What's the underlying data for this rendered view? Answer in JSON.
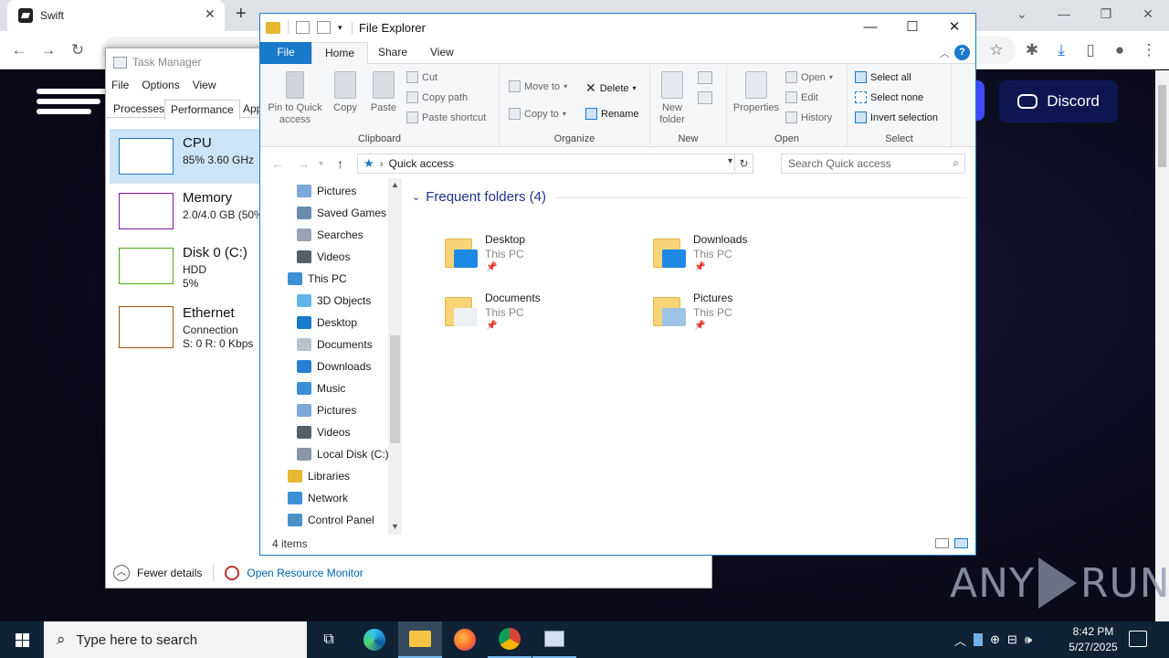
{
  "chrome": {
    "tab_title": "Swift",
    "tab_close": "✕",
    "new_tab": "+",
    "omnibox_text": "",
    "discord_label": "Discord"
  },
  "watermark": {
    "left": "ANY",
    "right": "RUN"
  },
  "taskmgr": {
    "title": "Task Manager",
    "menu": [
      "File",
      "Options",
      "View"
    ],
    "tabs": [
      "Processes",
      "Performance",
      "App"
    ],
    "items": [
      {
        "name": "CPU",
        "sub1": "85%  3.60 GHz",
        "sub2": "",
        "color": "#1979ca"
      },
      {
        "name": "Memory",
        "sub1": "2.0/4.0 GB (50%",
        "sub2": "",
        "color": "#8b12ae"
      },
      {
        "name": "Disk 0 (C:)",
        "sub1": "HDD",
        "sub2": "5%",
        "color": "#4da60c"
      },
      {
        "name": "Ethernet",
        "sub1": "Connection",
        "sub2": "S: 0  R: 0 Kbps",
        "color": "#a74f01"
      }
    ],
    "fewer_details": "Fewer details",
    "open_resmon": "Open Resource Monitor"
  },
  "explorer": {
    "title": "File Explorer",
    "ribbon_tabs": {
      "file": "File",
      "home": "Home",
      "share": "Share",
      "view": "View"
    },
    "clipboard": {
      "label": "Clipboard",
      "pin": "Pin to Quick access",
      "copy": "Copy",
      "paste": "Paste",
      "cut": "Cut",
      "copy_path": "Copy path",
      "paste_shortcut": "Paste shortcut"
    },
    "organize": {
      "label": "Organize",
      "move_to": "Move to",
      "copy_to": "Copy to",
      "delete": "Delete",
      "rename": "Rename"
    },
    "new": {
      "label": "New",
      "new_folder": "New folder"
    },
    "open": {
      "label": "Open",
      "properties": "Properties",
      "open": "Open",
      "edit": "Edit",
      "history": "History"
    },
    "select": {
      "label": "Select",
      "select_all": "Select all",
      "select_none": "Select none",
      "invert": "Invert selection"
    },
    "address": "Quick access",
    "search_placeholder": "Search Quick access",
    "nav": [
      {
        "label": "Pictures",
        "indent": 1,
        "icon": "#7da7d9"
      },
      {
        "label": "Saved Games",
        "indent": 1,
        "icon": "#6b8cae"
      },
      {
        "label": "Searches",
        "indent": 1,
        "icon": "#9aa4b0"
      },
      {
        "label": "Videos",
        "indent": 1,
        "icon": "#555d66"
      },
      {
        "label": "This PC",
        "indent": 0,
        "icon": "#3d8fd6"
      },
      {
        "label": "3D Objects",
        "indent": 1,
        "icon": "#5fb6e8"
      },
      {
        "label": "Desktop",
        "indent": 1,
        "icon": "#1979ca"
      },
      {
        "label": "Documents",
        "indent": 1,
        "icon": "#b8c2cc"
      },
      {
        "label": "Downloads",
        "indent": 1,
        "icon": "#2a7fd4"
      },
      {
        "label": "Music",
        "indent": 1,
        "icon": "#3a8fd9"
      },
      {
        "label": "Pictures",
        "indent": 1,
        "icon": "#7da7d9"
      },
      {
        "label": "Videos",
        "indent": 1,
        "icon": "#555d66"
      },
      {
        "label": "Local Disk (C:)",
        "indent": 1,
        "icon": "#8a96a3"
      },
      {
        "label": "Libraries",
        "indent": 0,
        "icon": "#e8b730"
      },
      {
        "label": "Network",
        "indent": 0,
        "icon": "#3d8fd6"
      },
      {
        "label": "Control Panel",
        "indent": 0,
        "icon": "#4a90c8"
      }
    ],
    "frequent_header": "Frequent folders (4)",
    "folders": [
      {
        "name": "Desktop",
        "location": "This PC",
        "overlay": "#1e88e5"
      },
      {
        "name": "Downloads",
        "location": "This PC",
        "overlay": "#1e88e5"
      },
      {
        "name": "Documents",
        "location": "This PC",
        "overlay": "#eef1f4"
      },
      {
        "name": "Pictures",
        "location": "This PC",
        "overlay": "#9fc3e6"
      }
    ],
    "status": "4 items"
  },
  "taskbar": {
    "search_placeholder": "Type here to search",
    "time": "8:42 PM",
    "date": "5/27/2025"
  }
}
